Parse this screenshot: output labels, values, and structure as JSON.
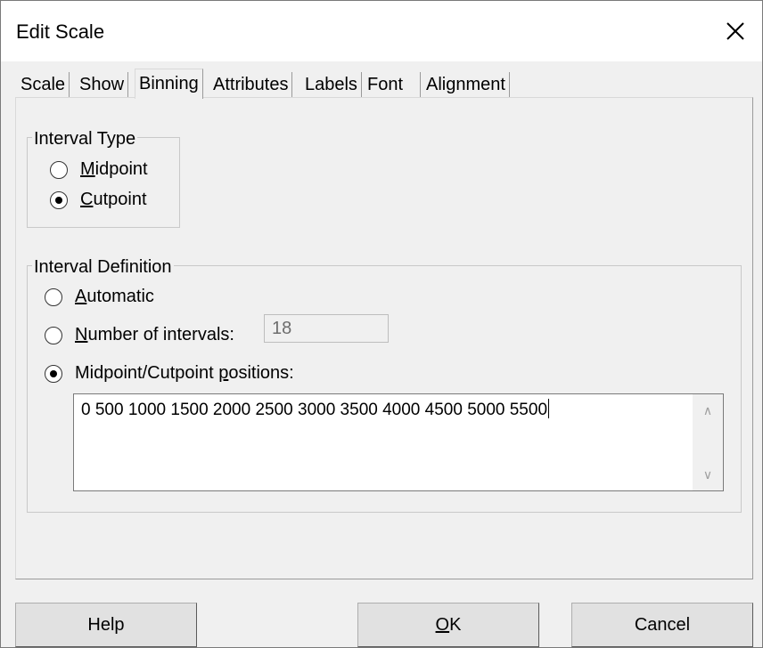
{
  "window": {
    "title": "Edit Scale",
    "close_icon": "close-icon"
  },
  "tabs": [
    {
      "label": "Scale",
      "active": false
    },
    {
      "label": "Show",
      "active": false
    },
    {
      "label": "Binning",
      "active": true
    },
    {
      "label": "Attributes",
      "active": false
    },
    {
      "label": "Labels",
      "active": false
    },
    {
      "label": "Font",
      "active": false
    },
    {
      "label": "Alignment",
      "active": false
    }
  ],
  "interval_type": {
    "label": "Interval Type",
    "options": [
      {
        "mnemonic": "M",
        "rest": "idpoint",
        "checked": false
      },
      {
        "mnemonic": "C",
        "rest": "utpoint",
        "checked": true
      }
    ]
  },
  "interval_definition": {
    "label": "Interval Definition",
    "automatic": {
      "mnemonic": "A",
      "rest": "utomatic",
      "checked": false
    },
    "number_of_intervals": {
      "mnemonic": "N",
      "rest": "umber of intervals:",
      "checked": false,
      "value": "18"
    },
    "positions": {
      "before": "Midpoint/Cutpoint ",
      "mnemonic": "p",
      "after": "ositions:",
      "checked": true,
      "value": "0 500 1000 1500 2000 2500 3000 3500 4000 4500 5000 5500"
    }
  },
  "buttons": {
    "help": "Help",
    "ok": {
      "mnemonic": "O",
      "rest": "K"
    },
    "cancel": "Cancel"
  }
}
